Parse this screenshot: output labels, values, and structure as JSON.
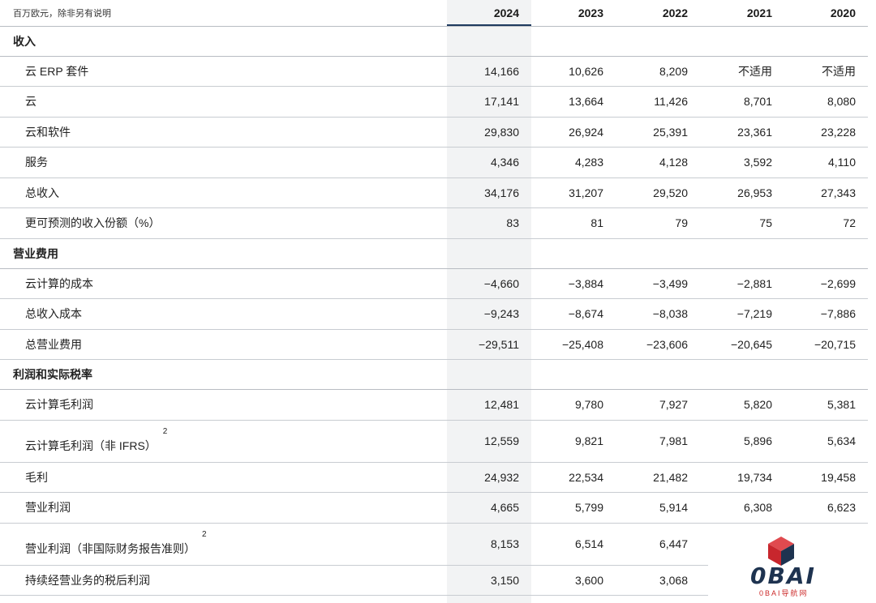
{
  "unit_label": "百万欧元，除非另有说明",
  "years": [
    "2024",
    "2023",
    "2022",
    "2021",
    "2020"
  ],
  "sections": [
    {
      "title": "收入",
      "rows": [
        {
          "label": "云 ERP 套件",
          "values": [
            "14,166",
            "10,626",
            "8,209",
            "不适用",
            "不适用"
          ]
        },
        {
          "label": "云",
          "values": [
            "17,141",
            "13,664",
            "11,426",
            "8,701",
            "8,080"
          ]
        },
        {
          "label": "云和软件",
          "values": [
            "29,830",
            "26,924",
            "25,391",
            "23,361",
            "23,228"
          ]
        },
        {
          "label": "服务",
          "values": [
            "4,346",
            "4,283",
            "4,128",
            "3,592",
            "4,110"
          ]
        },
        {
          "label": "总收入",
          "values": [
            "34,176",
            "31,207",
            "29,520",
            "26,953",
            "27,343"
          ]
        },
        {
          "label": "更可预测的收入份额（%）",
          "values": [
            "83",
            "81",
            "79",
            "75",
            "72"
          ]
        }
      ]
    },
    {
      "title": "营业费用",
      "rows": [
        {
          "label": "云计算的成本",
          "values": [
            "−4,660",
            "−3,884",
            "−3,499",
            "−2,881",
            "−2,699"
          ]
        },
        {
          "label": "总收入成本",
          "values": [
            "−9,243",
            "−8,674",
            "−8,038",
            "−7,219",
            "−7,886"
          ]
        },
        {
          "label": "总营业费用",
          "values": [
            "−29,511",
            "−25,408",
            "−23,606",
            "−20,645",
            "−20,715"
          ]
        }
      ]
    },
    {
      "title": "利润和实际税率",
      "rows": [
        {
          "label": "云计算毛利润",
          "values": [
            "12,481",
            "9,780",
            "7,927",
            "5,820",
            "5,381"
          ]
        },
        {
          "label": "云计算毛利润（非 IFRS）",
          "note": "2",
          "values": [
            "12,559",
            "9,821",
            "7,981",
            "5,896",
            "5,634"
          ]
        },
        {
          "label": "毛利",
          "values": [
            "24,932",
            "22,534",
            "21,482",
            "19,734",
            "19,458"
          ]
        },
        {
          "label": "营业利润",
          "values": [
            "4,665",
            "5,799",
            "5,914",
            "6,308",
            "6,623"
          ]
        },
        {
          "label": "营业利润（非国际财务报告准则）",
          "note": "2",
          "values": [
            "8,153",
            "6,514",
            "6,447",
            "",
            ""
          ]
        },
        {
          "label": "持续经营业务的税后利润",
          "values": [
            "3,150",
            "3,600",
            "3,068",
            "",
            ""
          ]
        }
      ]
    }
  ],
  "watermark": {
    "logo_text": "0BAI",
    "sub_text": "0BAI导航网",
    "colors": {
      "red": "#d9333a",
      "navy": "#1e3350"
    }
  }
}
